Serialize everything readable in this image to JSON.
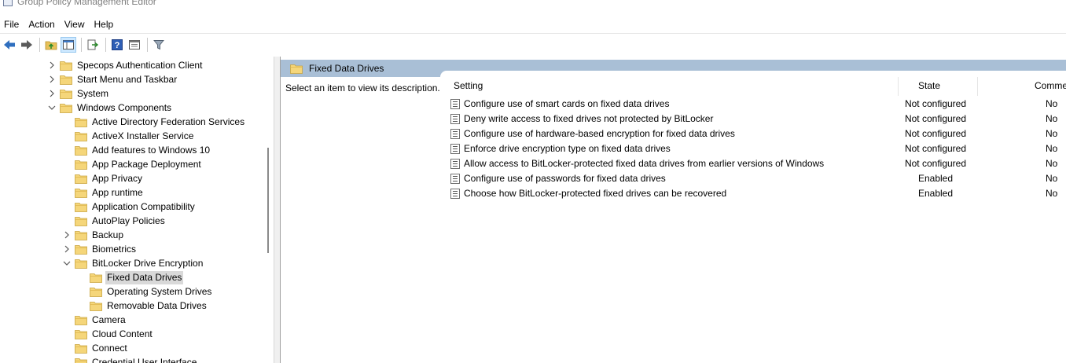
{
  "window": {
    "title": "Group Policy Management Editor"
  },
  "menu": [
    "File",
    "Action",
    "View",
    "Help"
  ],
  "toolbar": {
    "buttons": [
      "back-arrow-icon",
      "forward-arrow-icon",
      "up-folder-icon",
      "show-hide-tree-icon",
      "export-list-icon",
      "help-icon",
      "properties-icon",
      "filter-icon"
    ]
  },
  "tree": {
    "items": [
      {
        "label": "Specops Authentication Client",
        "indent": 0,
        "expander": "collapsed"
      },
      {
        "label": "Start Menu and Taskbar",
        "indent": 0,
        "expander": "collapsed"
      },
      {
        "label": "System",
        "indent": 0,
        "expander": "collapsed"
      },
      {
        "label": "Windows Components",
        "indent": 0,
        "expander": "expanded"
      },
      {
        "label": "Active Directory Federation Services",
        "indent": 1,
        "expander": "none"
      },
      {
        "label": "ActiveX Installer Service",
        "indent": 1,
        "expander": "none"
      },
      {
        "label": "Add features to Windows 10",
        "indent": 1,
        "expander": "none"
      },
      {
        "label": "App Package Deployment",
        "indent": 1,
        "expander": "none"
      },
      {
        "label": "App Privacy",
        "indent": 1,
        "expander": "none"
      },
      {
        "label": "App runtime",
        "indent": 1,
        "expander": "none"
      },
      {
        "label": "Application Compatibility",
        "indent": 1,
        "expander": "none"
      },
      {
        "label": "AutoPlay Policies",
        "indent": 1,
        "expander": "none"
      },
      {
        "label": "Backup",
        "indent": 1,
        "expander": "collapsed"
      },
      {
        "label": "Biometrics",
        "indent": 1,
        "expander": "collapsed"
      },
      {
        "label": "BitLocker Drive Encryption",
        "indent": 1,
        "expander": "expanded"
      },
      {
        "label": "Fixed Data Drives",
        "indent": 2,
        "expander": "none",
        "selected": true
      },
      {
        "label": "Operating System Drives",
        "indent": 2,
        "expander": "none"
      },
      {
        "label": "Removable Data Drives",
        "indent": 2,
        "expander": "none"
      },
      {
        "label": "Camera",
        "indent": 1,
        "expander": "none"
      },
      {
        "label": "Cloud Content",
        "indent": 1,
        "expander": "none"
      },
      {
        "label": "Connect",
        "indent": 1,
        "expander": "none"
      },
      {
        "label": "Credential User Interface",
        "indent": 1,
        "expander": "none"
      }
    ]
  },
  "details": {
    "header": "Fixed Data Drives",
    "description": "Select an item to view its description.",
    "columns": {
      "setting": "Setting",
      "state": "State",
      "comment": "Comme"
    },
    "rows": [
      {
        "setting": "Configure use of smart cards on fixed data drives",
        "state": "Not configured",
        "comment": "No"
      },
      {
        "setting": "Deny write access to fixed drives not protected by BitLocker",
        "state": "Not configured",
        "comment": "No"
      },
      {
        "setting": "Configure use of hardware-based encryption for fixed data drives",
        "state": "Not configured",
        "comment": "No"
      },
      {
        "setting": "Enforce drive encryption type on fixed data drives",
        "state": "Not configured",
        "comment": "No"
      },
      {
        "setting": "Allow access to BitLocker-protected fixed data drives from earlier versions of Windows",
        "state": "Not configured",
        "comment": "No"
      },
      {
        "setting": "Configure use of passwords for fixed data drives",
        "state": "Enabled",
        "comment": "No"
      },
      {
        "setting": "Choose how BitLocker-protected fixed drives can be recovered",
        "state": "Enabled",
        "comment": "No"
      }
    ]
  }
}
